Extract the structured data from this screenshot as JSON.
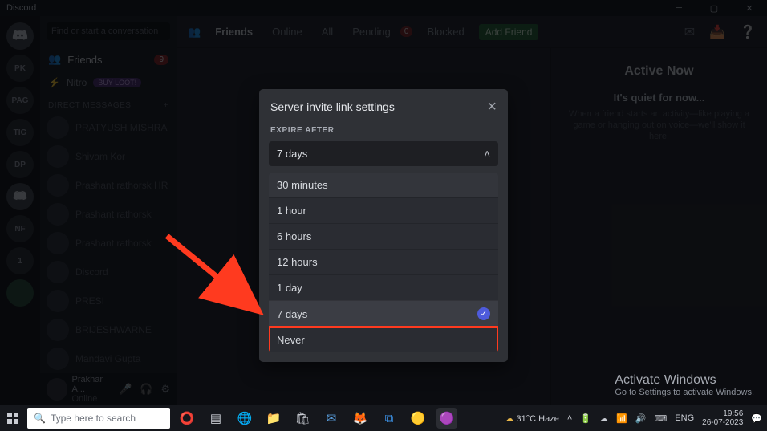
{
  "window": {
    "title": "Discord"
  },
  "guilds": [
    "PK",
    "PAG",
    "TIG",
    "DP",
    "1",
    "NF"
  ],
  "sidebar": {
    "search_placeholder": "Find or start a conversation",
    "friends_label": "Friends",
    "friends_badge": "9",
    "nitro_label": "Nitro",
    "nitro_badge": "BUY LOOT!",
    "dm_header": "DIRECT MESSAGES",
    "dm_items": [
      "PRATYUSH MISHRA",
      "Shivam Kor",
      "Prashant rathorsk HR",
      "Prashant rathorsk",
      "Prashant rathorsk",
      "Discord",
      "PRESI",
      "BRIJESHWARNE",
      "Mandavi Gupta"
    ],
    "user_name": "Prakhar A...",
    "user_status": "Online"
  },
  "topbar": {
    "icon_label": "Friends",
    "tabs": {
      "online": "Online",
      "all": "All",
      "pending": "Pending",
      "pending_badge": "0",
      "blocked": "Blocked"
    },
    "add_friend": "Add Friend"
  },
  "rightpanel": {
    "heading": "Active Now",
    "quiet_title": "It's quiet for now...",
    "quiet_sub": "When a friend starts an activity—like playing a game or hanging out on voice—we'll show it here!"
  },
  "modal": {
    "title": "Server invite link settings",
    "expire_label": "EXPIRE AFTER",
    "selected": "7 days",
    "options": [
      "30 minutes",
      "1 hour",
      "6 hours",
      "12 hours",
      "1 day",
      "7 days",
      "Never"
    ]
  },
  "activate": {
    "line1": "Activate Windows",
    "line2": "Go to Settings to activate Windows."
  },
  "taskbar": {
    "search_placeholder": "Type here to search",
    "weather": "31°C Haze",
    "lang": "ENG",
    "time": "19:56",
    "date": "26-07-2023"
  }
}
